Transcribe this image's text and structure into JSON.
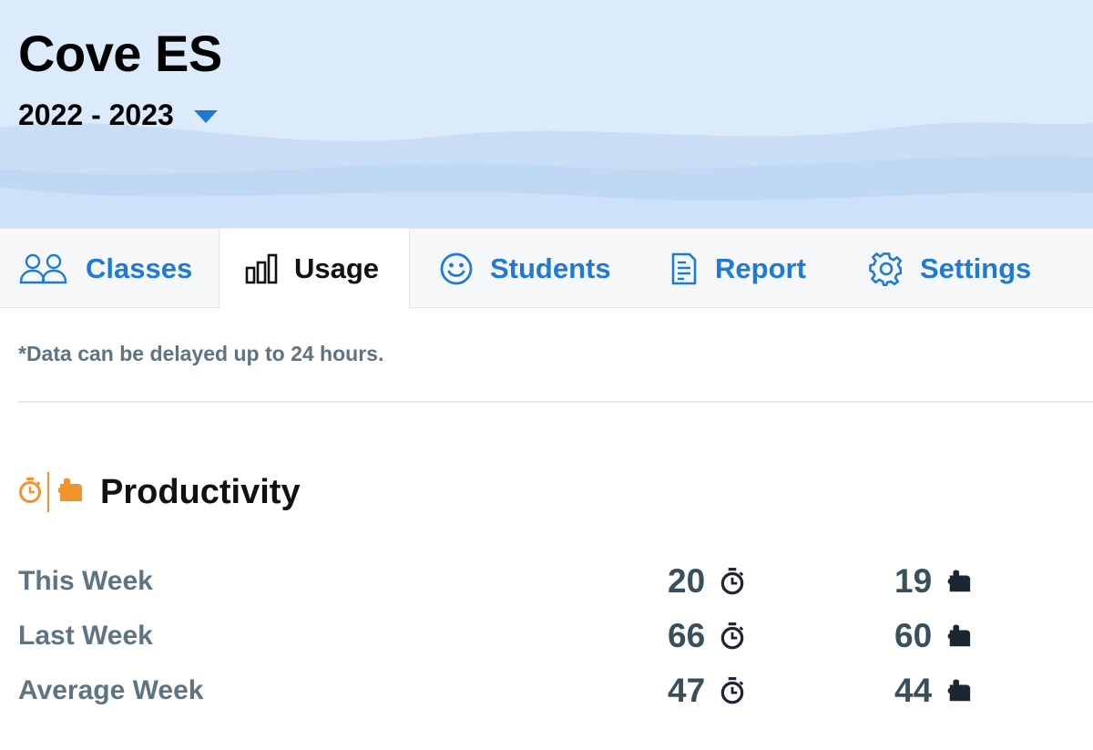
{
  "header": {
    "school_name": "Cove ES",
    "school_year": "2022 - 2023"
  },
  "tabs": [
    {
      "label": "Classes",
      "icon": "people-icon",
      "active": false
    },
    {
      "label": "Usage",
      "icon": "bar-chart-icon",
      "active": true
    },
    {
      "label": "Students",
      "icon": "smiley-icon",
      "active": false
    },
    {
      "label": "Report",
      "icon": "report-icon",
      "active": false
    },
    {
      "label": "Settings",
      "icon": "gear-icon",
      "active": false
    }
  ],
  "notice": "*Data can be delayed up to 24 hours.",
  "productivity": {
    "title": "Productivity",
    "rows": [
      {
        "label": "This Week",
        "time": "20",
        "puzzles": "19"
      },
      {
        "label": "Last Week",
        "time": "66",
        "puzzles": "60"
      },
      {
        "label": "Average Week",
        "time": "47",
        "puzzles": "44"
      }
    ]
  },
  "colors": {
    "accent": "#1f7ad4",
    "productivity_icon": "#f0922e",
    "muted_text": "#5f7482",
    "metric_text": "#3a4f5c"
  }
}
